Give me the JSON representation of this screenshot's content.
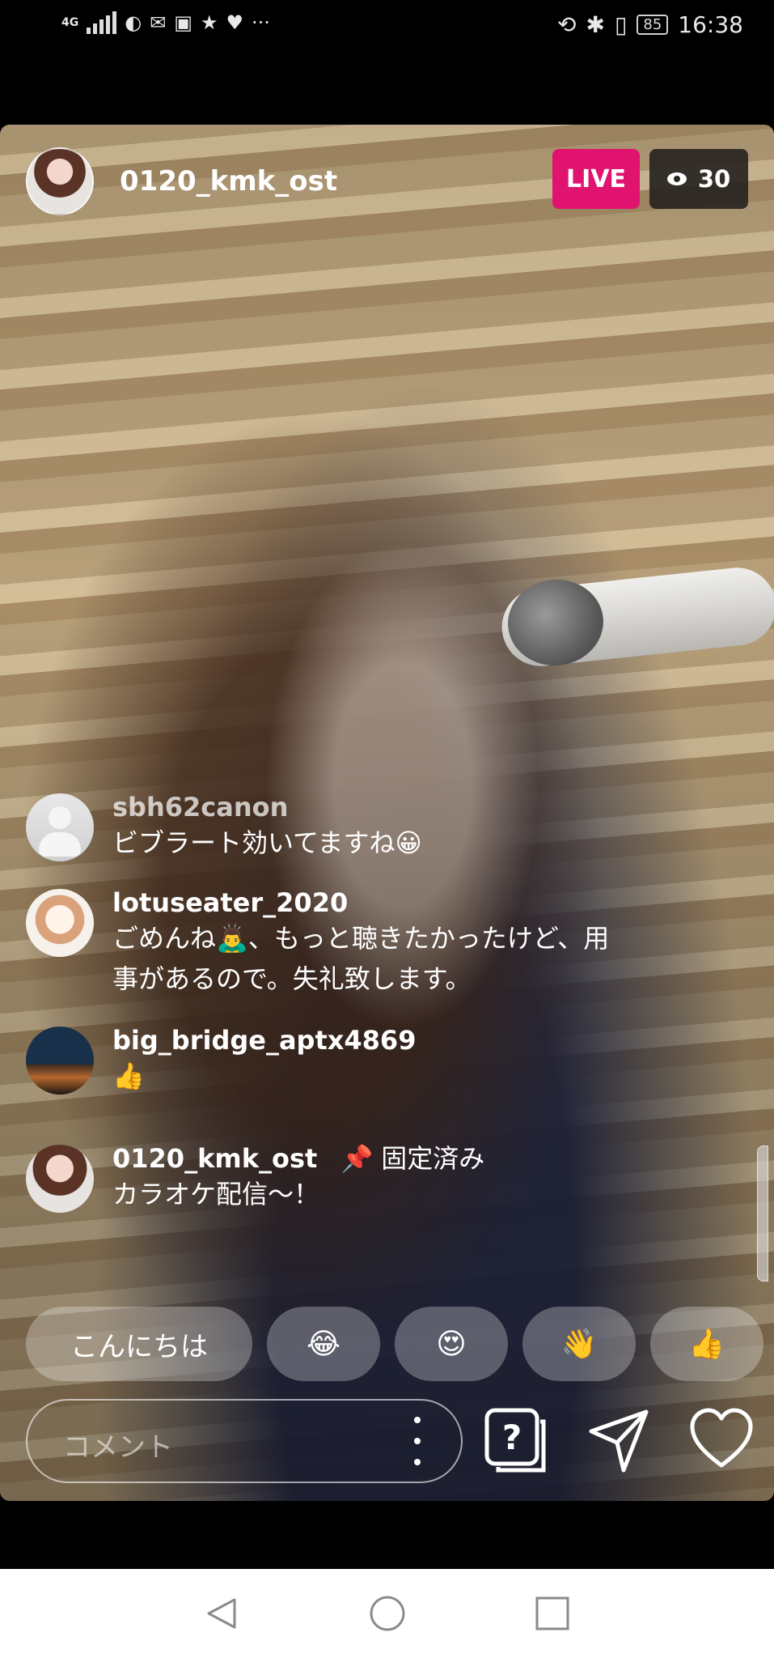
{
  "status_bar": {
    "network": "4G",
    "battery": "85",
    "time": "16:38",
    "left_icons": [
      "signal-icon",
      "carrier-logo-icon",
      "mail-icon",
      "app-icon",
      "star-icon",
      "heart-icon",
      "more-icon"
    ],
    "right_icons": [
      "data-sync-icon",
      "bluetooth-icon",
      "vibrate-icon"
    ]
  },
  "live": {
    "host_username": "0120_kmk_ost",
    "live_label": "LIVE",
    "viewer_count": "30"
  },
  "comments": [
    {
      "user": "sbh62canon",
      "text": "ビブラート効いてますね😀",
      "avatar": "default"
    },
    {
      "user": "lotuseater_2020",
      "text": "ごめんね🙇‍♂️、もっと聴きたかったけど、用事があるので。失礼致します。",
      "avatar": "anime"
    },
    {
      "user": "big_bridge_aptx4869",
      "text": "👍",
      "avatar": "city"
    },
    {
      "user": "0120_kmk_ost",
      "pinned_label": "固定済み",
      "text": "カラオケ配信〜！",
      "avatar": "host"
    }
  ],
  "quick_replies": [
    "こんにちは",
    "😂",
    "😍",
    "👋",
    "👍"
  ],
  "comment_box": {
    "placeholder": "コメント"
  },
  "actions": [
    "question-icon",
    "send-icon",
    "heart-icon"
  ],
  "colors": {
    "live_badge": "#e0136f",
    "viewer_badge": "#282421"
  }
}
